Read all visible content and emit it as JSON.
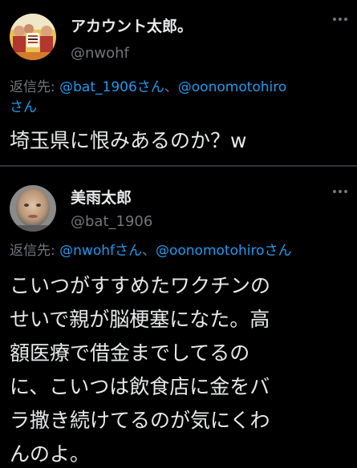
{
  "tweets": [
    {
      "display_name": "アカウント太郎。",
      "handle": "@nwohf",
      "reply_prefix": "返信先: ",
      "mention_1": "@bat_1906さん",
      "reply_separator": "、",
      "mention_2": "@oonomotohiro",
      "mention_2_suffix": "さん",
      "text": "埼玉県に恨みあるのか？w"
    },
    {
      "display_name": "美雨太郎",
      "handle": "@bat_1906",
      "reply_prefix": "返信先: ",
      "mention_1": "@nwohfさん",
      "reply_separator": "、",
      "mention_2": "@oonomotohiroさん",
      "text": "こいつがすすめたワクチンの\nせいで親が脳梗塞になた。高\n額医療で借金までしてるの\nに、こいつは飲食店に金をバ\nラ撒き続けてるのが気にくわ\nんのよ。"
    }
  ],
  "colors": {
    "background": "#000000",
    "primary_text": "#e7e9ea",
    "secondary_text": "#71767b",
    "link": "#1d9bf0",
    "divider": "#2f3336"
  },
  "icons": {
    "more": "more-horizontal-icon"
  }
}
